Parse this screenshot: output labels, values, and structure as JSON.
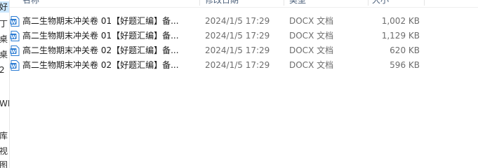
{
  "nav_pane": {
    "items": [
      {
        "label": "好"
      },
      {
        "label": "丁"
      },
      {
        "label": "桌"
      },
      {
        "label": "桌"
      },
      {
        "label": "2"
      },
      {
        "label": "WP"
      },
      {
        "label": "库"
      },
      {
        "label": "视"
      },
      {
        "label": "图"
      }
    ]
  },
  "columns": {
    "name": "名称",
    "date": "修改日期",
    "type": "类型",
    "size": "大小"
  },
  "files": [
    {
      "name": "高二生物期末冲关卷 01【好题汇编】备...",
      "date": "2024/1/5 17:29",
      "type": "DOCX 文档",
      "size": "1,002 KB",
      "icon": "word-doc-icon"
    },
    {
      "name": "高二生物期末冲关卷 01【好题汇编】备...",
      "date": "2024/1/5 17:29",
      "type": "DOCX 文档",
      "size": "1,129 KB",
      "icon": "word-doc-icon"
    },
    {
      "name": "高二生物期末冲关卷 02【好题汇编】备...",
      "date": "2024/1/5 17:29",
      "type": "DOCX 文档",
      "size": "620 KB",
      "icon": "word-doc-icon"
    },
    {
      "name": "高二生物期末冲关卷 02【好题汇编】备...",
      "date": "2024/1/5 17:29",
      "type": "DOCX 文档",
      "size": "596 KB",
      "icon": "word-doc-icon"
    }
  ],
  "colors": {
    "icon_blue": "#2b7cd3",
    "selection": "#cce8ff"
  }
}
